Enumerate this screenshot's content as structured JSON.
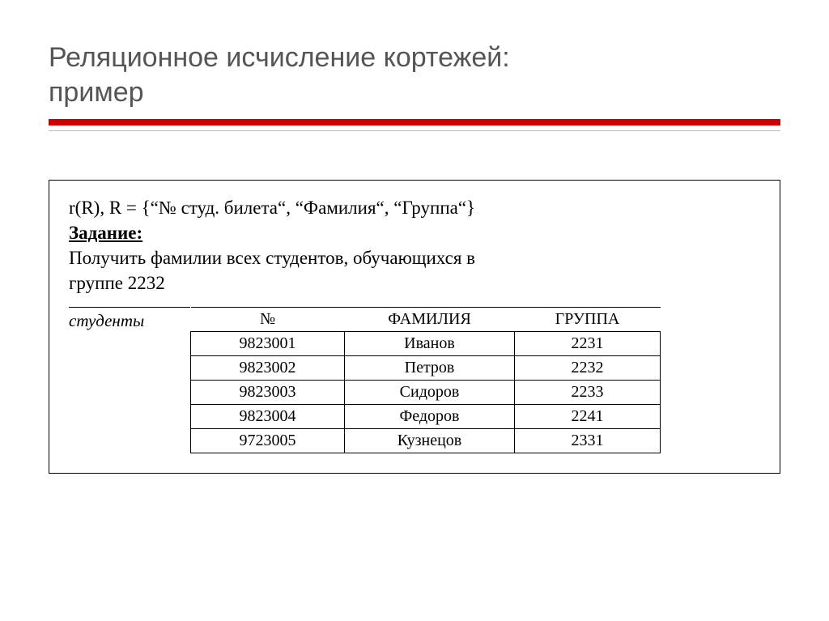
{
  "title_line1": "Реляционное исчисление кортежей:",
  "title_line2": "пример",
  "schema_def": "r(R), R = {“№ студ. билета“, “Фамилия“, “Группа“}",
  "task_label": "Задание:",
  "task_text1": "Получить фамилии всех студентов, обучающихся в",
  "task_text2": "группе 2232",
  "relation_name": "студенты",
  "headers": {
    "num": "№",
    "fam": "ФАМИЛИЯ",
    "grp": "ГРУППА"
  },
  "rows": [
    {
      "num": "9823001",
      "fam": "Иванов",
      "grp": "2231"
    },
    {
      "num": "9823002",
      "fam": "Петров",
      "grp": "2232"
    },
    {
      "num": "9823003",
      "fam": "Сидоров",
      "grp": "2233"
    },
    {
      "num": "9823004",
      "fam": "Федоров",
      "grp": "2241"
    },
    {
      "num": "9723005",
      "fam": "Кузнецов",
      "grp": "2331"
    }
  ]
}
